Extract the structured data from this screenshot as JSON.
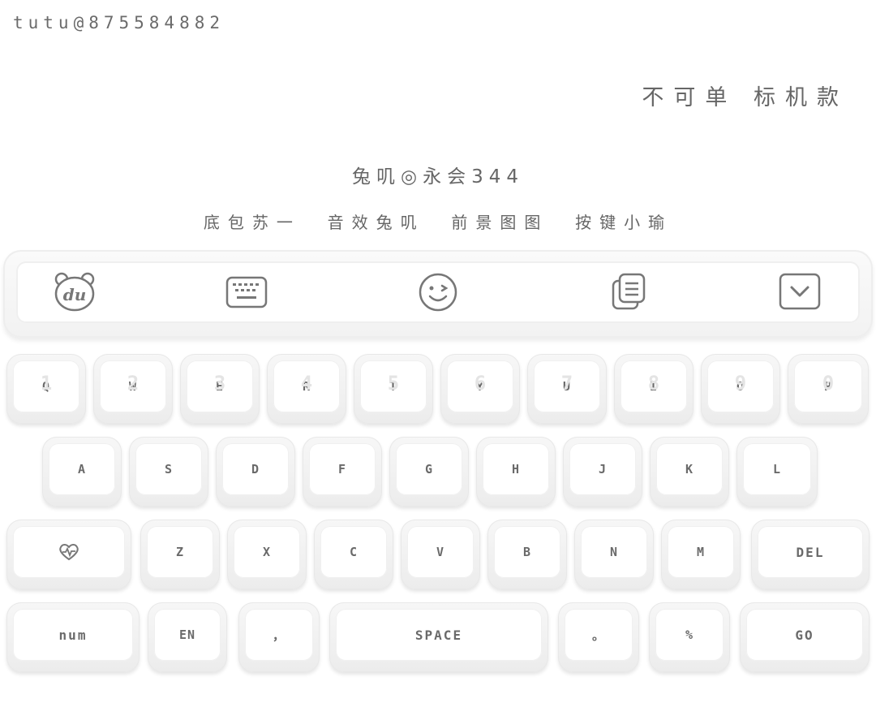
{
  "header": {
    "handle": "tutu@875584882",
    "tagline": "不可单 标机款",
    "subtitle": "兔叽◎永会344",
    "credits": "底包苏一  音效兔叽  前景图图  按键小瑜"
  },
  "toolbar": {
    "icons": [
      "du-logo-icon",
      "keyboard-icon",
      "emoji-icon",
      "clipboard-icon",
      "collapse-icon"
    ],
    "du_text": "du"
  },
  "keyboard": {
    "row1": [
      {
        "label": "Q",
        "hint": "1"
      },
      {
        "label": "W",
        "hint": "2"
      },
      {
        "label": "E",
        "hint": "3"
      },
      {
        "label": "R",
        "hint": "4"
      },
      {
        "label": "T",
        "hint": "5"
      },
      {
        "label": "Y",
        "hint": "6"
      },
      {
        "label": "U",
        "hint": "7"
      },
      {
        "label": "I",
        "hint": "8"
      },
      {
        "label": "O",
        "hint": "9"
      },
      {
        "label": "P",
        "hint": "0"
      }
    ],
    "row2": [
      "A",
      "S",
      "D",
      "F",
      "G",
      "H",
      "J",
      "K",
      "L"
    ],
    "row3_keys": [
      "Z",
      "X",
      "C",
      "V",
      "B",
      "N",
      "M"
    ],
    "shift_icon": "heart-shift-icon",
    "del_label": "DEL",
    "row4": {
      "num": "num",
      "lang": "EN",
      "comma": "，",
      "space": "SPACE",
      "period": "。",
      "percent": "%",
      "go": "GO"
    }
  },
  "colors": {
    "text": "#666666",
    "key_face": "#ffffff",
    "key_body": "#efefef",
    "icon_stroke": "#777777"
  }
}
